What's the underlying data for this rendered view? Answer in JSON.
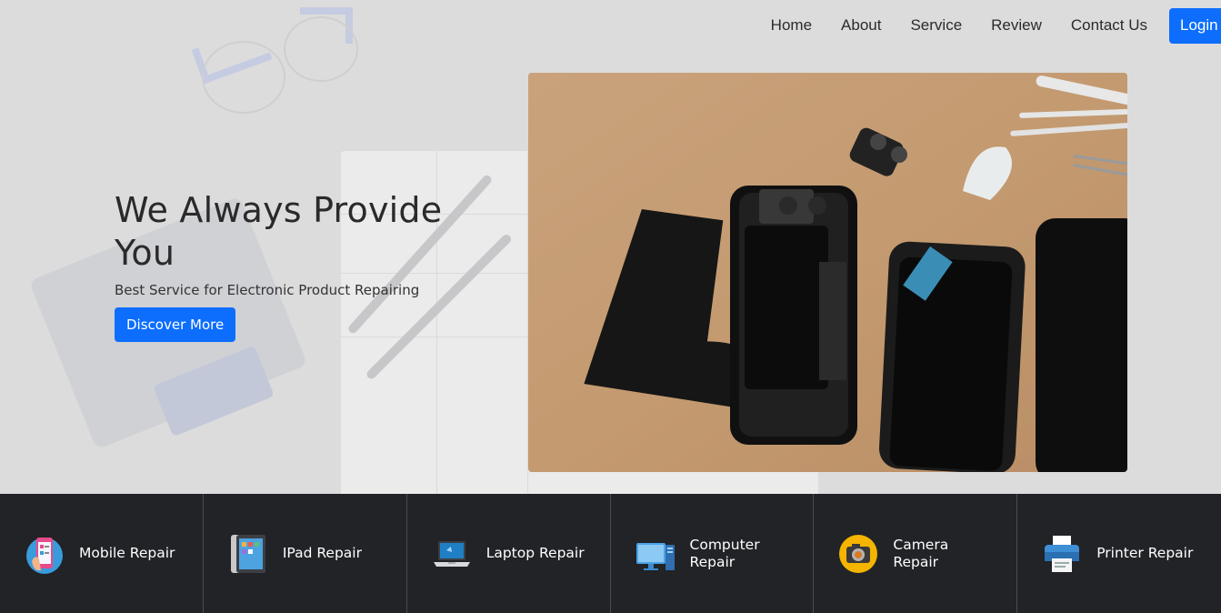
{
  "nav": {
    "links": [
      "Home",
      "About",
      "Service",
      "Review",
      "Contact Us"
    ],
    "login_label": "Login"
  },
  "hero": {
    "title": "We Always Provide You",
    "subtitle": "Best Service for Electronic Product Repairing",
    "cta_label": "Discover More"
  },
  "services": [
    {
      "label": "Mobile Repair",
      "icon": "mobile-repair-icon"
    },
    {
      "label": "IPad Repair",
      "icon": "ipad-icon"
    },
    {
      "label": "Laptop Repair",
      "icon": "laptop-icon"
    },
    {
      "label": "Computer Repair",
      "icon": "computer-icon"
    },
    {
      "label": "Camera Repair",
      "icon": "camera-icon"
    },
    {
      "label": "Printer Repair",
      "icon": "printer-icon"
    }
  ],
  "colors": {
    "accent": "#0d6efd",
    "service_bar": "#212327",
    "background": "#dcdcdd"
  }
}
